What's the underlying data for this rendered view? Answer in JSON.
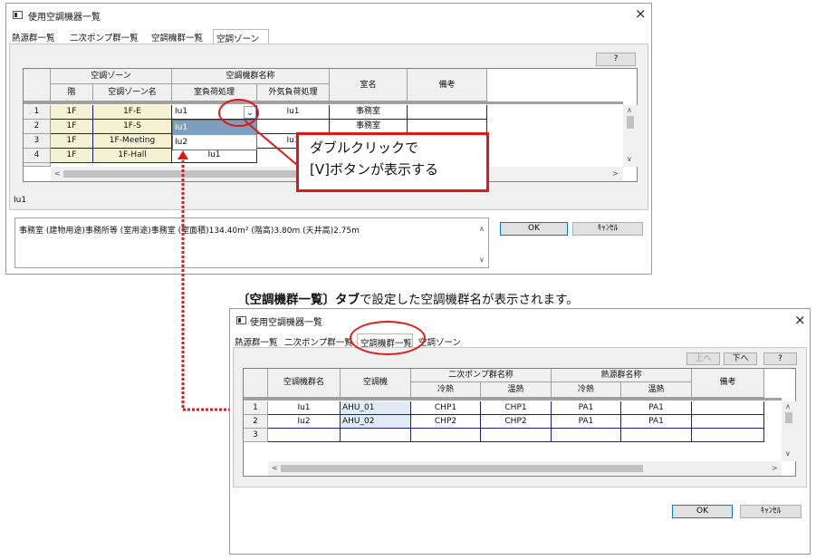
{
  "win1": {
    "title": "使用空調機器一覧",
    "close": "×",
    "tabs": [
      "熱源群一覧",
      "二次ポンプ群一覧",
      "空調機群一覧",
      "空調ゾーン"
    ],
    "help_label": "?",
    "grid": {
      "hdr_zone": "空調ゾーン",
      "hdr_group": "空調機群名称",
      "hdr_floor": "階",
      "hdr_zone_name": "空調ゾーン名",
      "hdr_room_load": "室負荷処理",
      "hdr_outdoor_load": "外気負荷処理",
      "hdr_room": "室名",
      "hdr_note": "備考",
      "rows": [
        {
          "no": "1",
          "floor": "1F",
          "zone": "1F-E",
          "room_load": "Iu1",
          "outdoor": "Iu1",
          "room": "事務室"
        },
        {
          "no": "2",
          "floor": "1F",
          "zone": "1F-S",
          "room_load": "",
          "outdoor": "",
          "room": "事務室"
        },
        {
          "no": "3",
          "floor": "1F",
          "zone": "1F-Meeting",
          "room_load": "",
          "outdoor": "Iu1",
          "room": ""
        },
        {
          "no": "4",
          "floor": "1F",
          "zone": "1F-Hall",
          "room_load": "Iu1",
          "outdoor": "",
          "room": ""
        }
      ],
      "dropdown_btn": "⌄",
      "dropdown_items": [
        "Iu1",
        "Iu2"
      ]
    },
    "status_value": "Iu1",
    "info_text": "事務室 (建物用途)事務所等 (室用途)事務室 (室面積)134.40m² (階高)3.80m (天井高)2.75m",
    "ok_label": "OK",
    "cancel_label": "ｷｬﾝｾﾙ"
  },
  "callout": {
    "line1": "ダブルクリックで",
    "line2": "[V]ボタンが表示する"
  },
  "caption": {
    "bold_part": "〔空調機群一覧〕タブ",
    "rest": "で設定した空調機群名が表示されます。"
  },
  "win2": {
    "title": "使用空調機器一覧",
    "close": "×",
    "tabs": [
      "熱源群一覧",
      "二次ポンプ群一覧",
      "空調機群一覧",
      "空調ゾーン"
    ],
    "up_label": "上へ",
    "down_label": "下へ",
    "help_label": "?",
    "grid": {
      "hdr_group_name": "空調機群名",
      "hdr_ahu": "空調機",
      "hdr_pump": "二次ポンプ群名称",
      "hdr_source": "熱源群名称",
      "hdr_cool": "冷熱",
      "hdr_heat": "温熱",
      "hdr_note": "備考",
      "rows": [
        {
          "no": "1",
          "name": "Iu1",
          "ahu": "AHU_01",
          "p_cool": "CHP1",
          "p_heat": "CHP1",
          "s_cool": "PA1",
          "s_heat": "PA1"
        },
        {
          "no": "2",
          "name": "Iu2",
          "ahu": "AHU_02",
          "p_cool": "CHP2",
          "p_heat": "CHP2",
          "s_cool": "PA1",
          "s_heat": "PA1"
        },
        {
          "no": "3",
          "name": "",
          "ahu": "",
          "p_cool": "",
          "p_heat": "",
          "s_cool": "",
          "s_heat": ""
        }
      ]
    },
    "ok_label": "OK",
    "cancel_label": "ｷｬﾝｾﾙ"
  },
  "colors": {
    "annotation_red": "#e01818",
    "grid_line": "#1b1b9a",
    "focus_blue": "#0078d7"
  }
}
